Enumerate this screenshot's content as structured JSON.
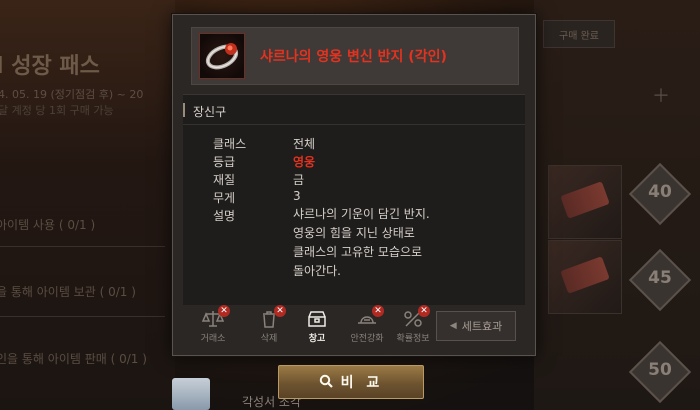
{
  "background": {
    "pass_title": "l 성장 패스",
    "pass_period": "4. 05. 19 (정기점검 후) ~ 20",
    "pass_note": "달 계정 당 1회 구매 가능",
    "missions": [
      "아이템 사용 ( 0/1 )",
      "을 통해 아이템 보관 ( 0/1 )",
      "인을 통해 아이템 판매 ( 0/1 )"
    ],
    "right_tab": "구매 완료",
    "level_badges": [
      "40",
      "45",
      "50"
    ],
    "bottom_item_name": "각성서 조각"
  },
  "tooltip": {
    "item_name": "샤르나의 영웅 변신 반지 (각인)",
    "category": "장신구",
    "rows": [
      {
        "label": "클래스",
        "value": "전체"
      },
      {
        "label": "등급",
        "value": "영웅"
      },
      {
        "label": "재질",
        "value": "금"
      },
      {
        "label": "무게",
        "value": "3"
      }
    ],
    "desc_label": "설명",
    "description_lines": [
      "샤르나의 기운이 담긴 반지.",
      "영웅의 힘을 지닌 상태로",
      "클래스의 고유한 모습으로",
      "돌아간다."
    ],
    "actions": [
      {
        "label": "거래소",
        "icon": "scale-icon",
        "disabled": true
      },
      {
        "label": "삭제",
        "icon": "trash-icon",
        "disabled": true
      },
      {
        "label": "창고",
        "icon": "chest-icon",
        "disabled": false
      },
      {
        "label": "안전강화",
        "icon": "enchant-icon",
        "disabled": true
      },
      {
        "label": "확률정보",
        "icon": "probability-icon",
        "disabled": true
      }
    ],
    "set_effect_label": "세트효과"
  },
  "compare_button_label": "비 교",
  "colors": {
    "item_name": "#e3321f",
    "grade_hero": "#e3321f",
    "compare_button": "#7a5e36"
  }
}
